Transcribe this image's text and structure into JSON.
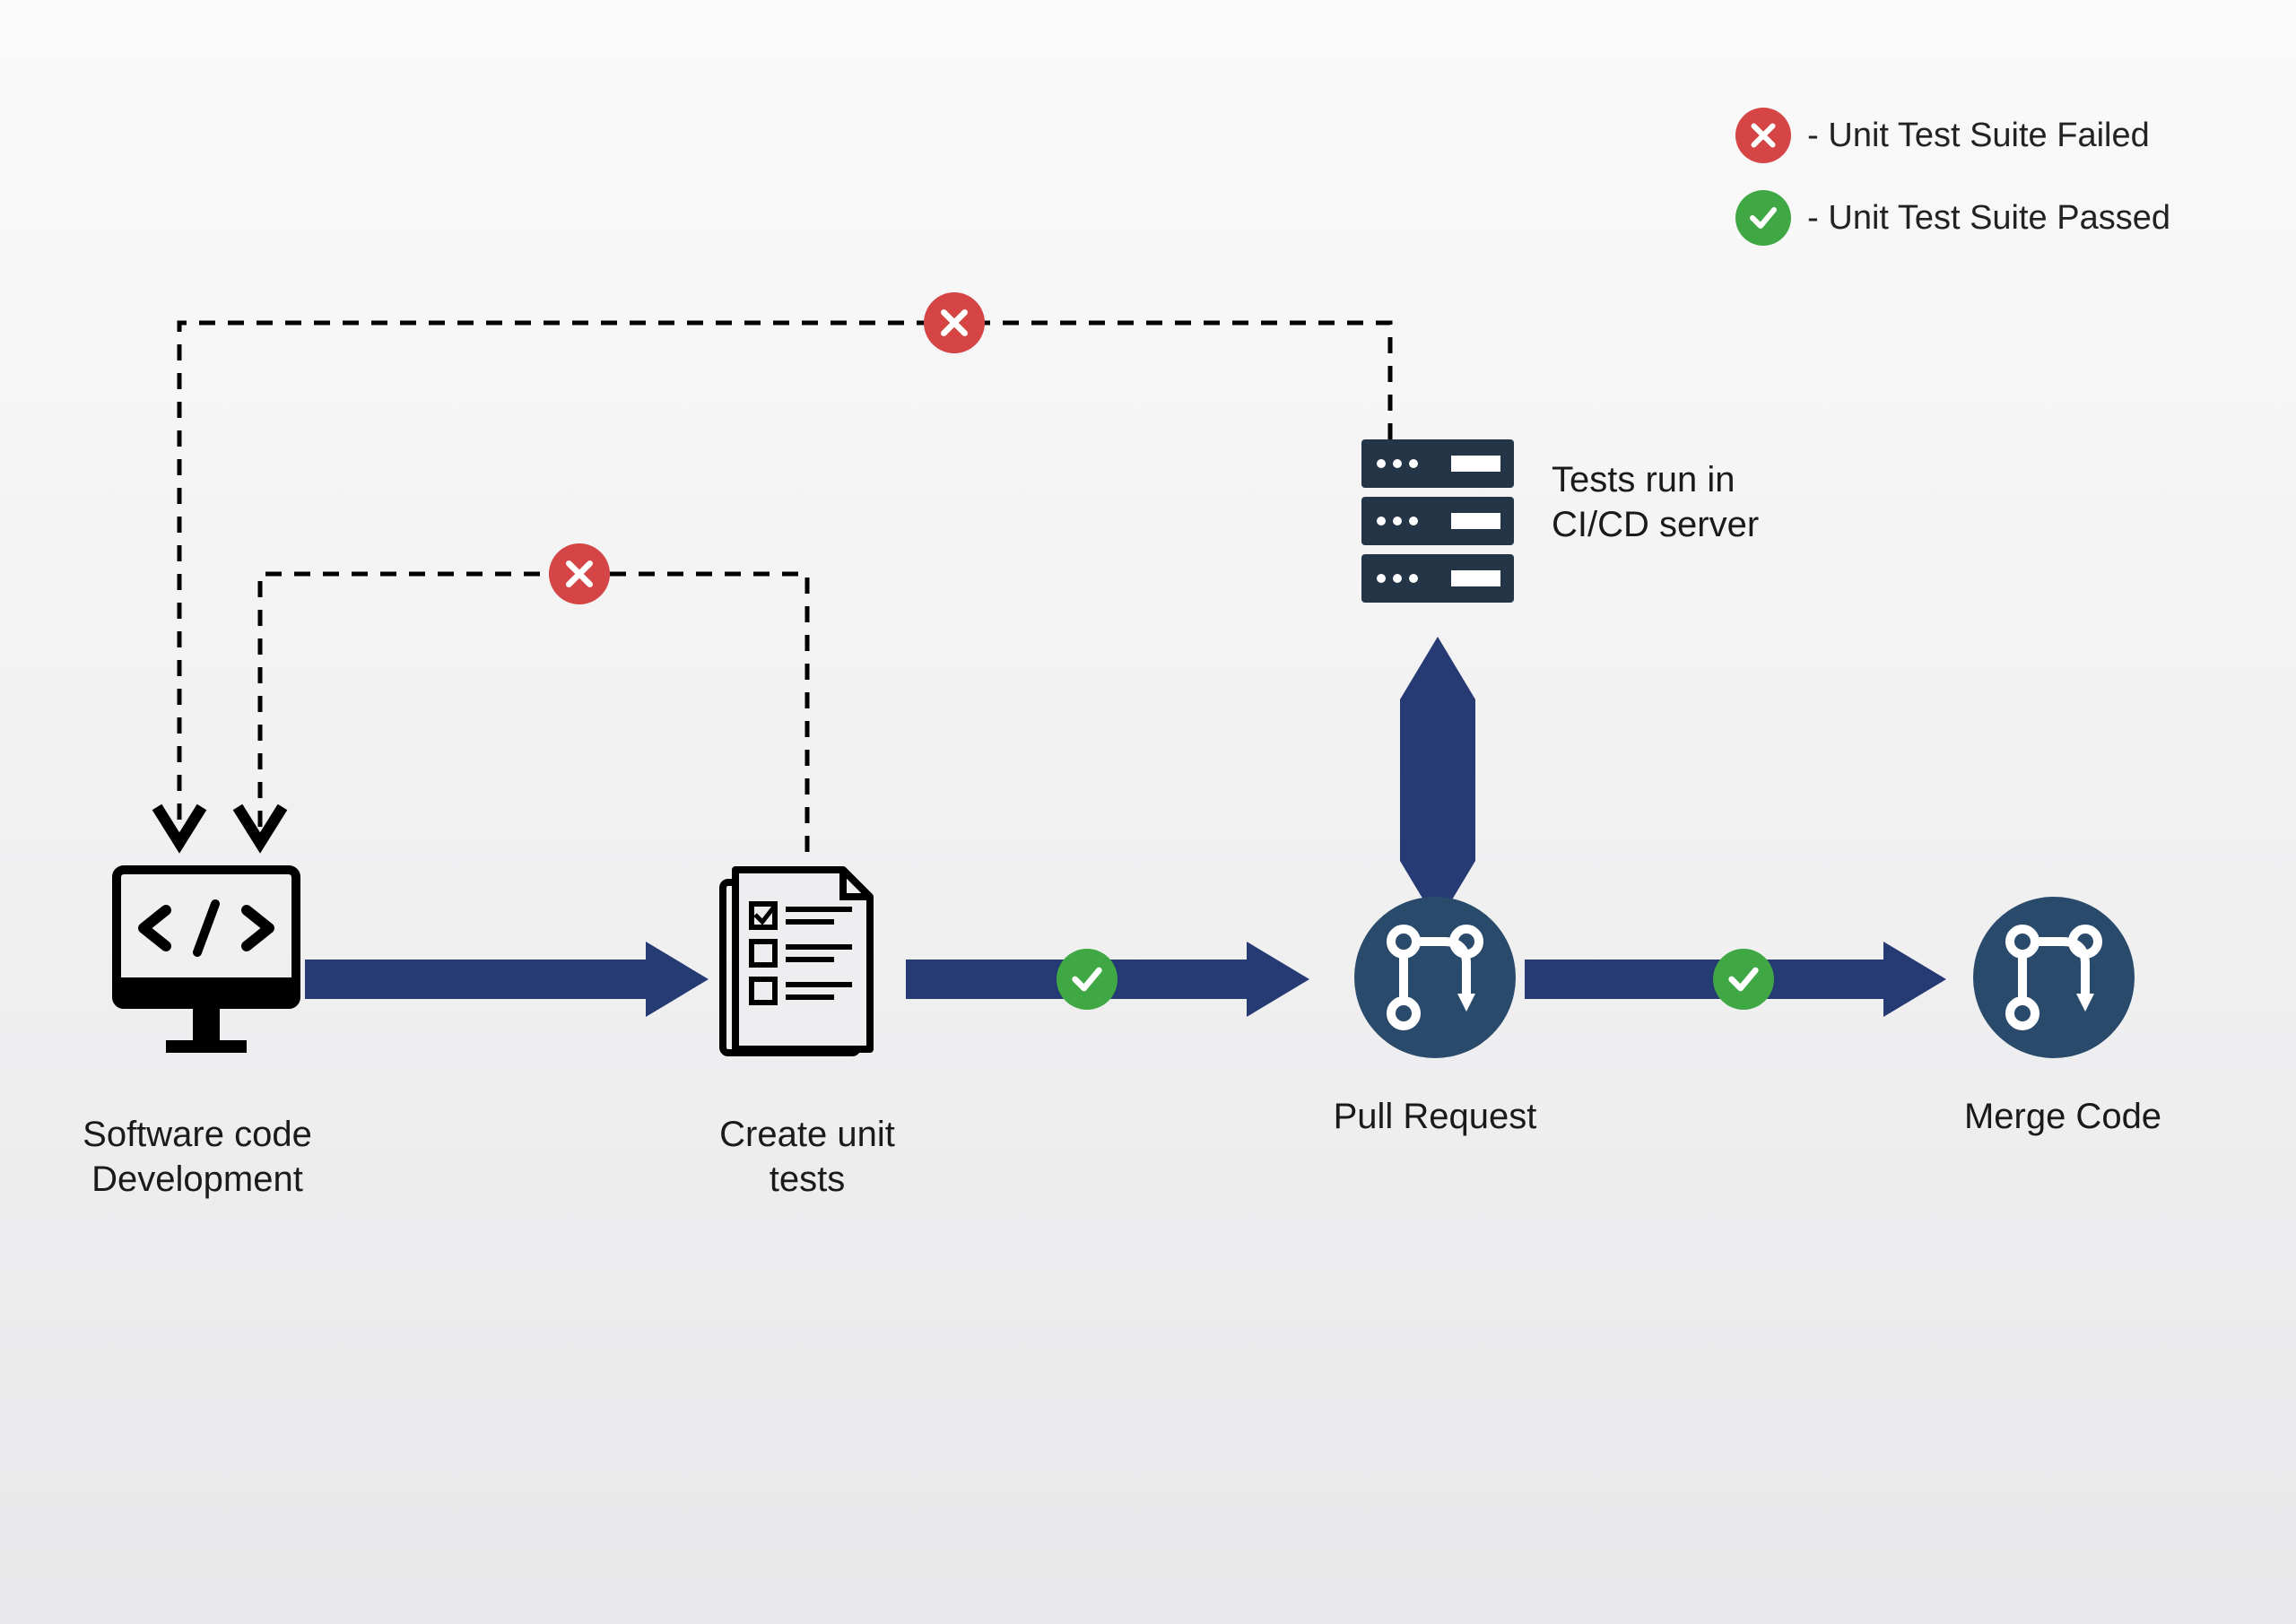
{
  "legend": {
    "fail_label": "- Unit Test Suite Failed",
    "pass_label": "- Unit Test Suite Passed"
  },
  "nodes": {
    "dev": "Software code\nDevelopment",
    "unit_tests": "Create unit\ntests",
    "pull_request": "Pull Request",
    "merge_code": "Merge Code",
    "ci_server": "Tests run in\nCI/CD server"
  },
  "colors": {
    "fail": "#d64545",
    "pass": "#3fa845",
    "arrow": "#263a74",
    "git_circle": "#2a4a6b",
    "server": "#243548"
  }
}
